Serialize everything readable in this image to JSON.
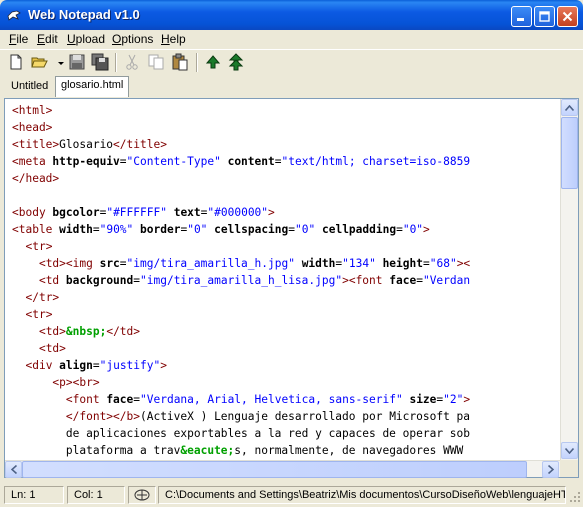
{
  "window": {
    "title": "Web Notepad v1.0"
  },
  "menu": {
    "items": [
      {
        "first": "F",
        "rest": "ile"
      },
      {
        "first": "E",
        "rest": "dit"
      },
      {
        "first": "U",
        "rest": "pload"
      },
      {
        "first": "O",
        "rest": "ptions"
      },
      {
        "first": "H",
        "rest": "elp"
      }
    ]
  },
  "toolbar": {
    "icons": [
      "new-file-icon",
      "open-folder-icon",
      "dropdown-arrow-icon",
      "save-icon",
      "save-all-icon",
      "cut-icon",
      "copy-icon",
      "paste-icon",
      "upload-icon",
      "upload-all-icon"
    ]
  },
  "tabs": [
    {
      "label": "Untitled",
      "active": false
    },
    {
      "label": "glosario.html",
      "active": true
    }
  ],
  "editor": {
    "lines": [
      [
        [
          "t",
          "<html>"
        ]
      ],
      [
        [
          "t",
          "<head>"
        ]
      ],
      [
        [
          "t",
          "<title>"
        ],
        [
          "txt",
          "Glosario"
        ],
        [
          "t",
          "</title>"
        ]
      ],
      [
        [
          "t",
          "<meta "
        ],
        [
          "a",
          "http-equiv"
        ],
        [
          "txt",
          "="
        ],
        [
          "v",
          "\"Content-Type\""
        ],
        [
          "txt",
          " "
        ],
        [
          "a",
          "content"
        ],
        [
          "txt",
          "="
        ],
        [
          "v",
          "\"text/html; charset=iso-8859"
        ]
      ],
      [
        [
          "t",
          "</head>"
        ]
      ],
      [],
      [
        [
          "t",
          "<body "
        ],
        [
          "a",
          "bgcolor"
        ],
        [
          "txt",
          "="
        ],
        [
          "v",
          "\"#FFFFFF\""
        ],
        [
          "txt",
          " "
        ],
        [
          "a",
          "text"
        ],
        [
          "txt",
          "="
        ],
        [
          "v",
          "\"#000000\""
        ],
        [
          "t",
          ">"
        ]
      ],
      [
        [
          "t",
          "<table "
        ],
        [
          "a",
          "width"
        ],
        [
          "txt",
          "="
        ],
        [
          "v",
          "\"90%\""
        ],
        [
          "txt",
          " "
        ],
        [
          "a",
          "border"
        ],
        [
          "txt",
          "="
        ],
        [
          "v",
          "\"0\""
        ],
        [
          "txt",
          " "
        ],
        [
          "a",
          "cellspacing"
        ],
        [
          "txt",
          "="
        ],
        [
          "v",
          "\"0\""
        ],
        [
          "txt",
          " "
        ],
        [
          "a",
          "cellpadding"
        ],
        [
          "txt",
          "="
        ],
        [
          "v",
          "\"0\""
        ],
        [
          "t",
          ">"
        ]
      ],
      [
        [
          "txt",
          "  "
        ],
        [
          "t",
          "<tr>"
        ]
      ],
      [
        [
          "txt",
          "    "
        ],
        [
          "t",
          "<td><img "
        ],
        [
          "a",
          "src"
        ],
        [
          "txt",
          "="
        ],
        [
          "v",
          "\"img/tira_amarilla_h.jpg\""
        ],
        [
          "txt",
          " "
        ],
        [
          "a",
          "width"
        ],
        [
          "txt",
          "="
        ],
        [
          "v",
          "\"134\""
        ],
        [
          "txt",
          " "
        ],
        [
          "a",
          "height"
        ],
        [
          "txt",
          "="
        ],
        [
          "v",
          "\"68\""
        ],
        [
          "t",
          "><"
        ]
      ],
      [
        [
          "txt",
          "    "
        ],
        [
          "t",
          "<td "
        ],
        [
          "a",
          "background"
        ],
        [
          "txt",
          "="
        ],
        [
          "v",
          "\"img/tira_amarilla_h_lisa.jpg\""
        ],
        [
          "t",
          "><font "
        ],
        [
          "a",
          "face"
        ],
        [
          "txt",
          "="
        ],
        [
          "v",
          "\"Verdan"
        ]
      ],
      [
        [
          "txt",
          "  "
        ],
        [
          "t",
          "</tr>"
        ]
      ],
      [
        [
          "txt",
          "  "
        ],
        [
          "t",
          "<tr>"
        ]
      ],
      [
        [
          "txt",
          "    "
        ],
        [
          "t",
          "<td>"
        ],
        [
          "e",
          "&nbsp;"
        ],
        [
          "t",
          "</td>"
        ]
      ],
      [
        [
          "txt",
          "    "
        ],
        [
          "t",
          "<td>"
        ]
      ],
      [
        [
          "txt",
          "  "
        ],
        [
          "t",
          "<div "
        ],
        [
          "a",
          "align"
        ],
        [
          "txt",
          "="
        ],
        [
          "v",
          "\"justify\""
        ],
        [
          "t",
          ">"
        ]
      ],
      [
        [
          "txt",
          "      "
        ],
        [
          "t",
          "<p><br>"
        ]
      ],
      [
        [
          "txt",
          "        "
        ],
        [
          "t",
          "<font "
        ],
        [
          "a",
          "face"
        ],
        [
          "txt",
          "="
        ],
        [
          "v",
          "\"Verdana, Arial, Helvetica, sans-serif\""
        ],
        [
          "txt",
          " "
        ],
        [
          "a",
          "size"
        ],
        [
          "txt",
          "="
        ],
        [
          "v",
          "\"2\""
        ],
        [
          "t",
          ">"
        ]
      ],
      [
        [
          "txt",
          "        "
        ],
        [
          "t",
          "</font></b>"
        ],
        [
          "txt",
          "(ActiveX ) Lenguaje desarrollado por Microsoft pa"
        ]
      ],
      [
        [
          "txt",
          "        de aplicaciones exportables a la red y capaces de operar sob"
        ]
      ],
      [
        [
          "txt",
          "        plataforma a trav"
        ],
        [
          "e",
          "&eacute;"
        ],
        [
          "txt",
          "s, normalmente, de navegadores WWW"
        ]
      ]
    ]
  },
  "status": {
    "line": "Ln: 1",
    "col": "Col: 1",
    "path": "C:\\Documents and Settings\\Beatriz\\Mis documentos\\CursoDiseñoWeb\\lenguajeHTML"
  }
}
